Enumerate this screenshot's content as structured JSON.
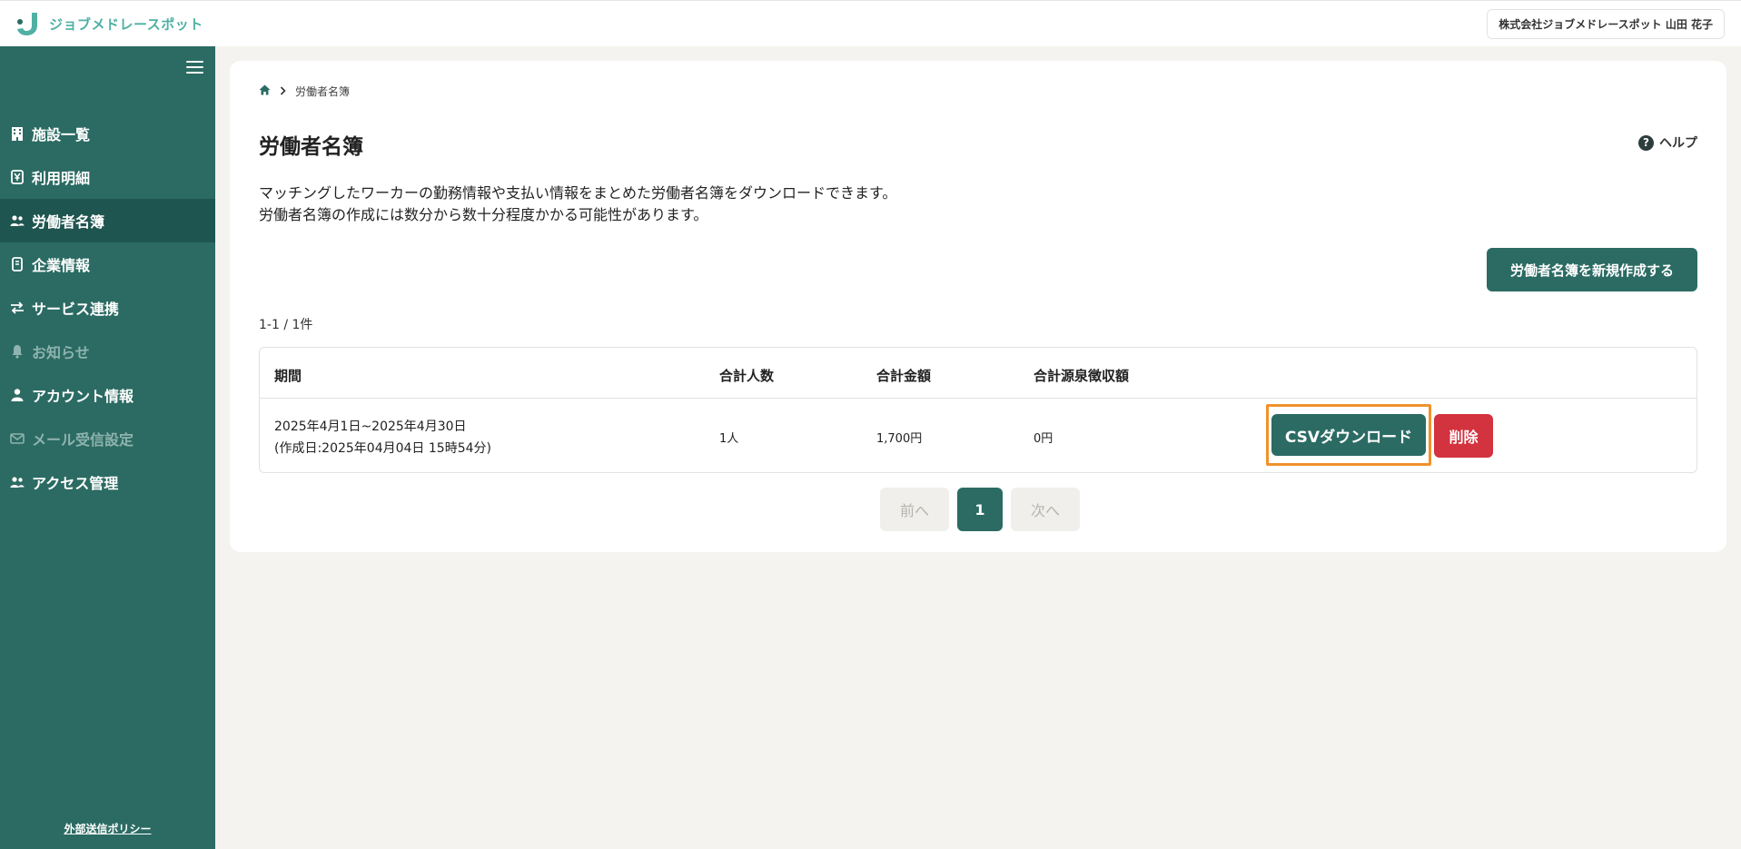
{
  "header": {
    "logo_text": "ジョブメドレースポット",
    "user_label": "株式会社ジョブメドレースポット 山田 花子"
  },
  "sidebar": {
    "items": [
      {
        "label": "施設一覧",
        "icon": "building-icon"
      },
      {
        "label": "利用明細",
        "icon": "yen-icon"
      },
      {
        "label": "労働者名簿",
        "icon": "users-icon"
      },
      {
        "label": "企業情報",
        "icon": "document-icon"
      },
      {
        "label": "サービス連携",
        "icon": "swap-icon"
      },
      {
        "label": "お知らせ",
        "icon": "bell-icon"
      },
      {
        "label": "アカウント情報",
        "icon": "person-icon"
      },
      {
        "label": "メール受信設定",
        "icon": "mail-icon"
      },
      {
        "label": "アクセス管理",
        "icon": "users-icon"
      }
    ],
    "active": "労働者名簿",
    "disabled": [
      "お知らせ",
      "メール受信設定"
    ],
    "footer_link": "外部送信ポリシー"
  },
  "breadcrumb": {
    "current": "労働者名簿"
  },
  "page": {
    "title": "労働者名簿",
    "help_label": "ヘルプ",
    "description_line1": "マッチングしたワーカーの勤務情報や支払い情報をまとめた労働者名簿をダウンロードできます。",
    "description_line2": "労働者名簿の作成には数分から数十分程度かかる可能性があります。",
    "create_button": "労働者名簿を新規作成する",
    "result_count": "1-1 / 1件"
  },
  "table": {
    "headers": [
      "期間",
      "合計人数",
      "合計金額",
      "合計源泉徴収額"
    ],
    "rows": [
      {
        "period": "2025年4月1日~2025年4月30日",
        "created": "(作成日:2025年04月04日 15時54分)",
        "people": "1人",
        "amount": "1,700円",
        "withholding": "0円",
        "csv_label": "CSVダウンロード",
        "delete_label": "削除"
      }
    ]
  },
  "pagination": {
    "prev": "前へ",
    "current": "1",
    "next": "次へ"
  },
  "colors": {
    "primary": "#2b6b63",
    "danger": "#d3323f",
    "highlight": "#f0922b",
    "logo": "#4fb0a3"
  }
}
